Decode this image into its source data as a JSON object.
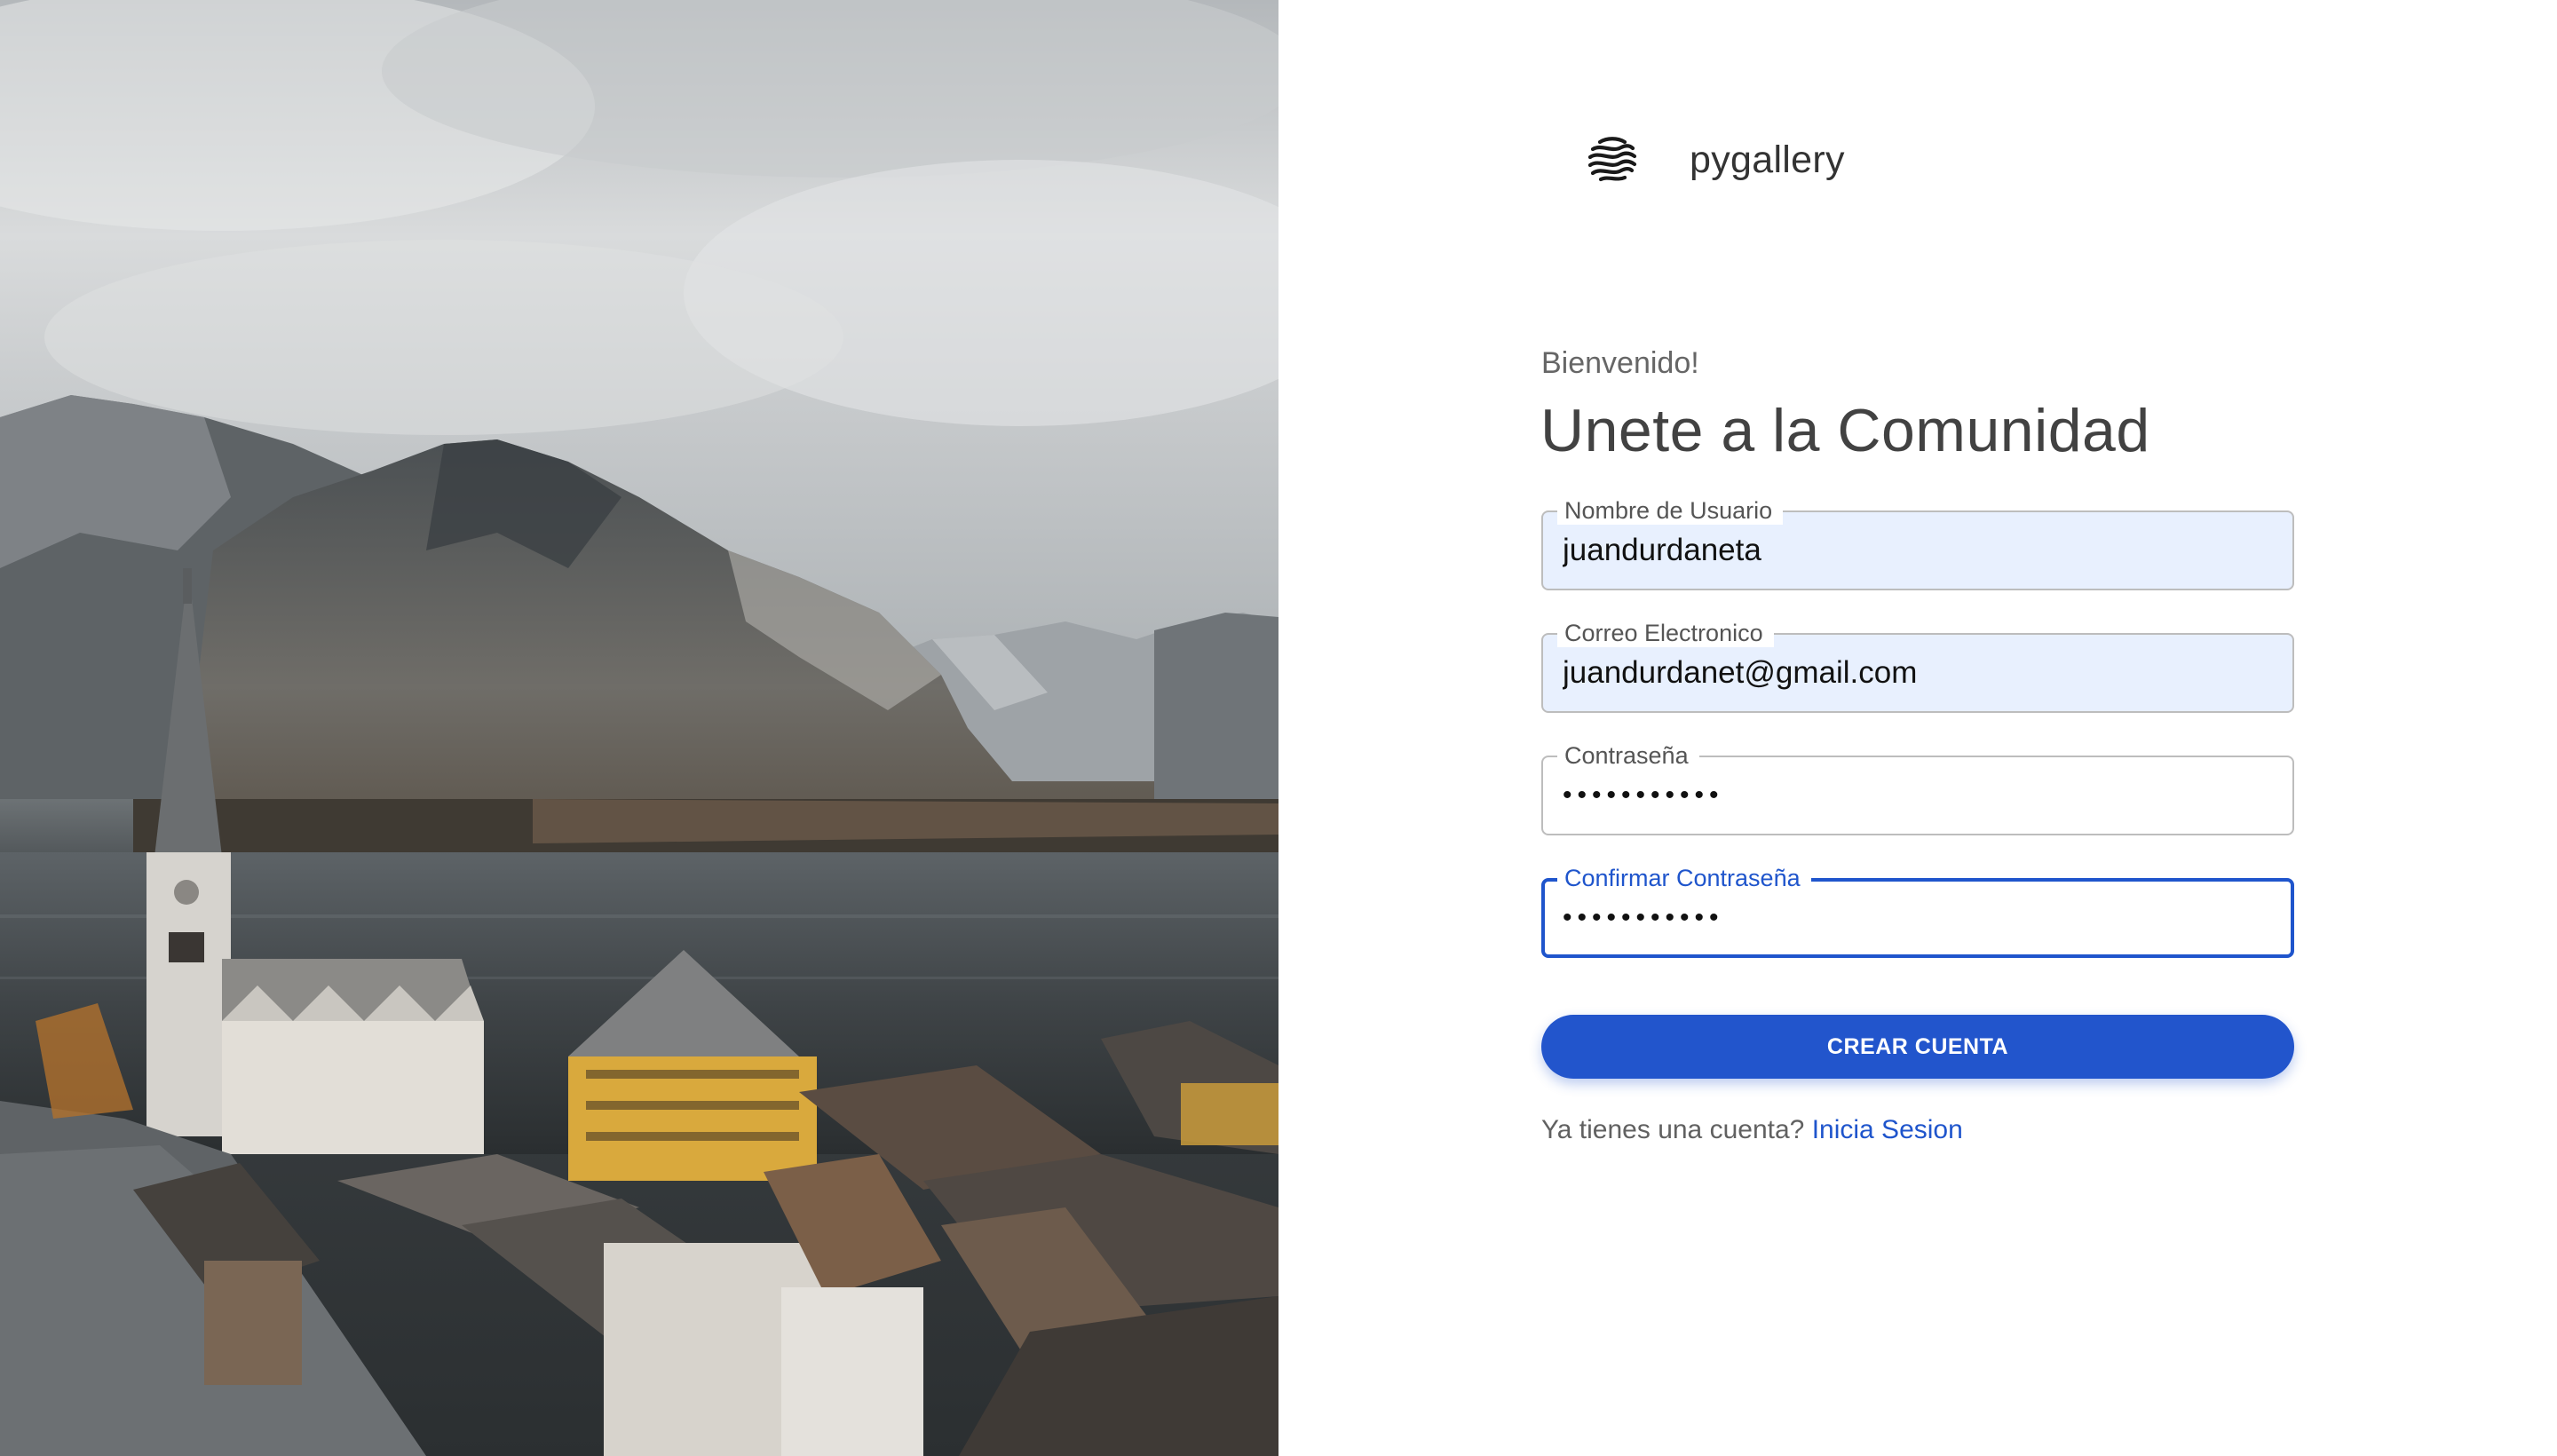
{
  "brand": {
    "name": "pygallery",
    "logo_icon": "wave-globe-icon"
  },
  "hero": {
    "subtitle": "Bienvenido!",
    "title": "Unete a la Comunidad"
  },
  "form": {
    "username": {
      "label": "Nombre de Usuario",
      "value": "juandurdaneta"
    },
    "email": {
      "label": "Correo Electronico",
      "value": "juandurdanet@gmail.com"
    },
    "password": {
      "label": "Contraseña",
      "value": "•••••••••••"
    },
    "confirm_password": {
      "label": "Confirmar Contraseña",
      "value": "•••••••••••"
    },
    "submit_label": "CREAR CUENTA"
  },
  "footer": {
    "prompt": "Ya tienes una cuenta?",
    "link_label": "Inicia Sesion"
  },
  "colors": {
    "primary": "#2255cc",
    "autofill_background": "#e8f0fe",
    "border": "#bdbdbd",
    "text_dark": "#424242",
    "text_muted": "#666666"
  }
}
